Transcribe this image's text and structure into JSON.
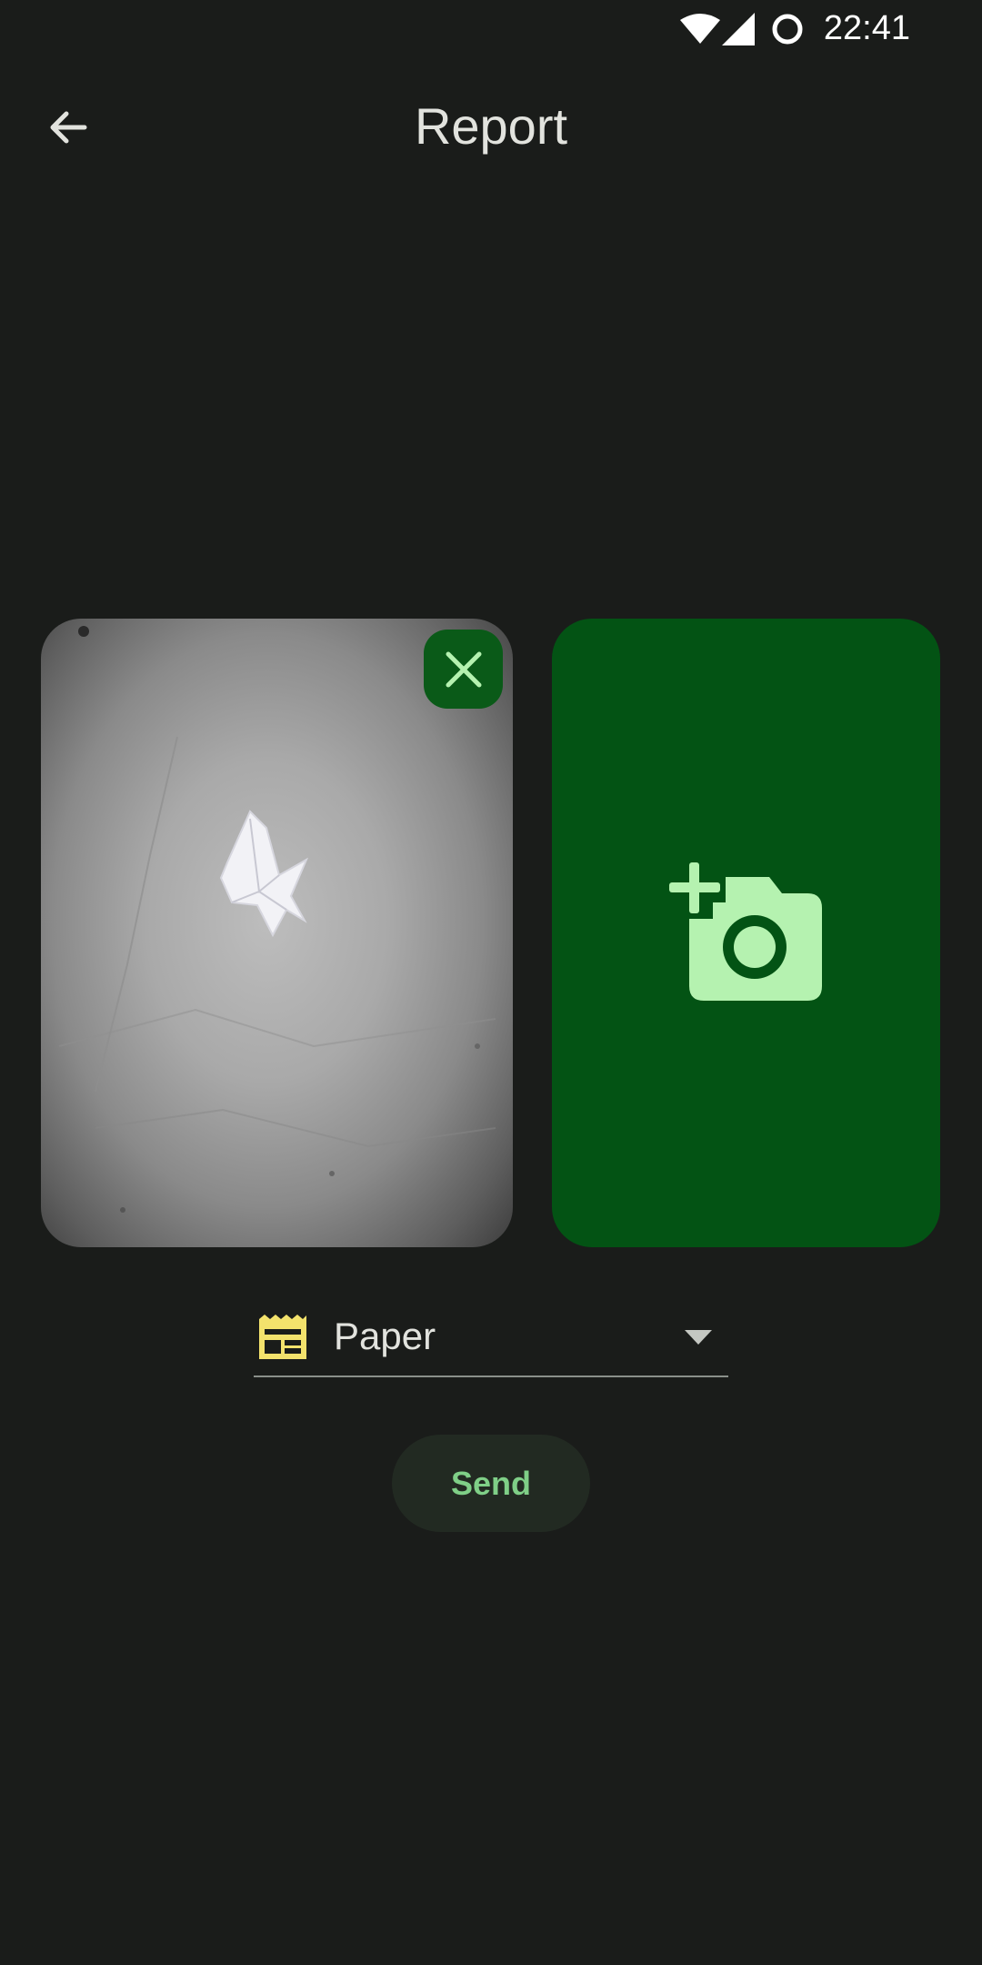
{
  "status_bar": {
    "time": "22:41",
    "icons": [
      "wifi-icon",
      "signal-icon",
      "circle-status-icon"
    ]
  },
  "header": {
    "title": "Report",
    "back_icon": "arrow-back-icon"
  },
  "photos": {
    "remove_icon": "close-icon",
    "add_icon": "add-a-photo-icon"
  },
  "category": {
    "selected": "Paper",
    "icon": "paper-icon",
    "arrow_icon": "dropdown-arrow-icon"
  },
  "actions": {
    "send_label": "Send"
  },
  "colors": {
    "background": "#1a1c1a",
    "accent_green": "#035314",
    "icon_light_green": "#b5f2b0",
    "send_text": "#7fcf87",
    "paper_icon": "#f3e26c"
  }
}
